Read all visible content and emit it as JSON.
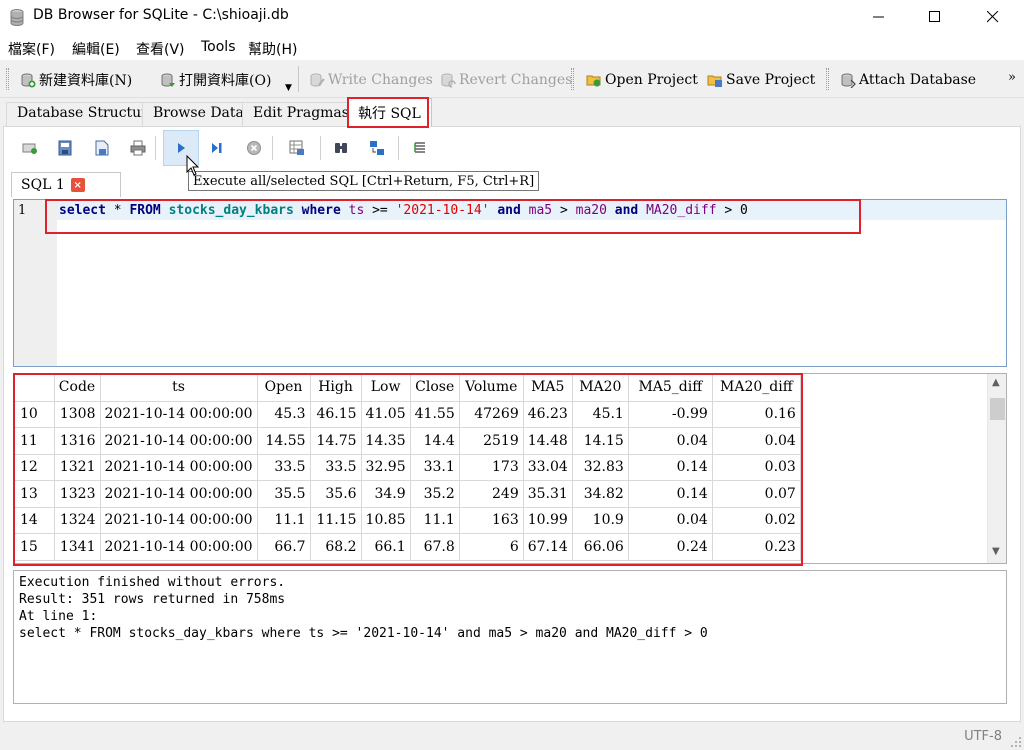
{
  "window": {
    "title": "DB Browser for SQLite - C:\\shioaji.db"
  },
  "menu": [
    "檔案(F)",
    "編輯(E)",
    "查看(V)",
    "Tools",
    "幫助(H)"
  ],
  "toolbar": {
    "new_db": "新建資料庫(N)",
    "open_db": "打開資料庫(O)",
    "write_changes": "Write Changes",
    "revert_changes": "Revert Changes",
    "open_project": "Open Project",
    "save_project": "Save Project",
    "attach_db": "Attach Database",
    "more": "»"
  },
  "tabs": [
    "Database Structure",
    "Browse Data",
    "Edit Pragmas",
    "執行 SQL"
  ],
  "active_tab": "執行 SQL",
  "sql_toolbar": {
    "tooltip": "Execute all/selected SQL [Ctrl+Return, F5, Ctrl+R]"
  },
  "editor_tab": {
    "label": "SQL 1",
    "close": "×"
  },
  "editor": {
    "line_number": "1",
    "tokens": {
      "select": "select",
      "star": " * ",
      "from": "FROM",
      "sp1": " ",
      "table": "stocks_day_kbars",
      "sp2": " ",
      "where": "where",
      "sp3": " ",
      "ts": "ts",
      "gte": " >= ",
      "date": "'2021-10-14'",
      "sp4": " ",
      "and1": "and",
      "sp5": " ",
      "ma5": "ma5",
      "gt1": " > ",
      "ma20": "ma20",
      "sp6": " ",
      "and2": "and",
      "sp7": " ",
      "ma20diff": "MA20_diff",
      "gt2": " > 0"
    }
  },
  "results": {
    "columns": [
      "Code",
      "ts",
      "Open",
      "High",
      "Low",
      "Close",
      "Volume",
      "MA5",
      "MA20",
      "MA5_diff",
      "MA20_diff"
    ],
    "rows": [
      [
        "10",
        "1308",
        "2021-10-14 00:00:00",
        "45.3",
        "46.15",
        "41.05",
        "41.55",
        "47269",
        "46.23",
        "45.1",
        "-0.99",
        "0.16"
      ],
      [
        "11",
        "1316",
        "2021-10-14 00:00:00",
        "14.55",
        "14.75",
        "14.35",
        "14.4",
        "2519",
        "14.48",
        "14.15",
        "0.04",
        "0.04"
      ],
      [
        "12",
        "1321",
        "2021-10-14 00:00:00",
        "33.5",
        "33.5",
        "32.95",
        "33.1",
        "173",
        "33.04",
        "32.83",
        "0.14",
        "0.03"
      ],
      [
        "13",
        "1323",
        "2021-10-14 00:00:00",
        "35.5",
        "35.6",
        "34.9",
        "35.2",
        "249",
        "35.31",
        "34.82",
        "0.14",
        "0.07"
      ],
      [
        "14",
        "1324",
        "2021-10-14 00:00:00",
        "11.1",
        "11.15",
        "10.85",
        "11.1",
        "163",
        "10.99",
        "10.9",
        "0.04",
        "0.02"
      ],
      [
        "15",
        "1341",
        "2021-10-14 00:00:00",
        "66.7",
        "68.2",
        "66.1",
        "67.8",
        "6",
        "67.14",
        "66.06",
        "0.24",
        "0.23"
      ]
    ]
  },
  "messages": [
    "Execution finished without errors.",
    "Result: 351 rows returned in 758ms",
    "At line 1:",
    "select * FROM stocks_day_kbars where ts >= '2021-10-14' and ma5 > ma20 and MA20_diff > 0"
  ],
  "status": {
    "encoding": "UTF-8"
  },
  "colors": {
    "highlight_box": "#e0202a",
    "keyword": "#000080",
    "table": "#008080",
    "column": "#800080",
    "string": "#e00000"
  },
  "icons": [
    "database-icon",
    "new-db-icon",
    "open-db-icon",
    "write-changes-icon",
    "revert-changes-icon",
    "open-project-icon",
    "save-project-icon",
    "attach-db-icon",
    "open-tab-icon",
    "open-file-icon",
    "save-file-icon",
    "print-icon",
    "execute-all-icon",
    "execute-line-icon",
    "stop-icon",
    "save-results-icon",
    "find-icon",
    "find-replace-icon",
    "comment-icon"
  ]
}
